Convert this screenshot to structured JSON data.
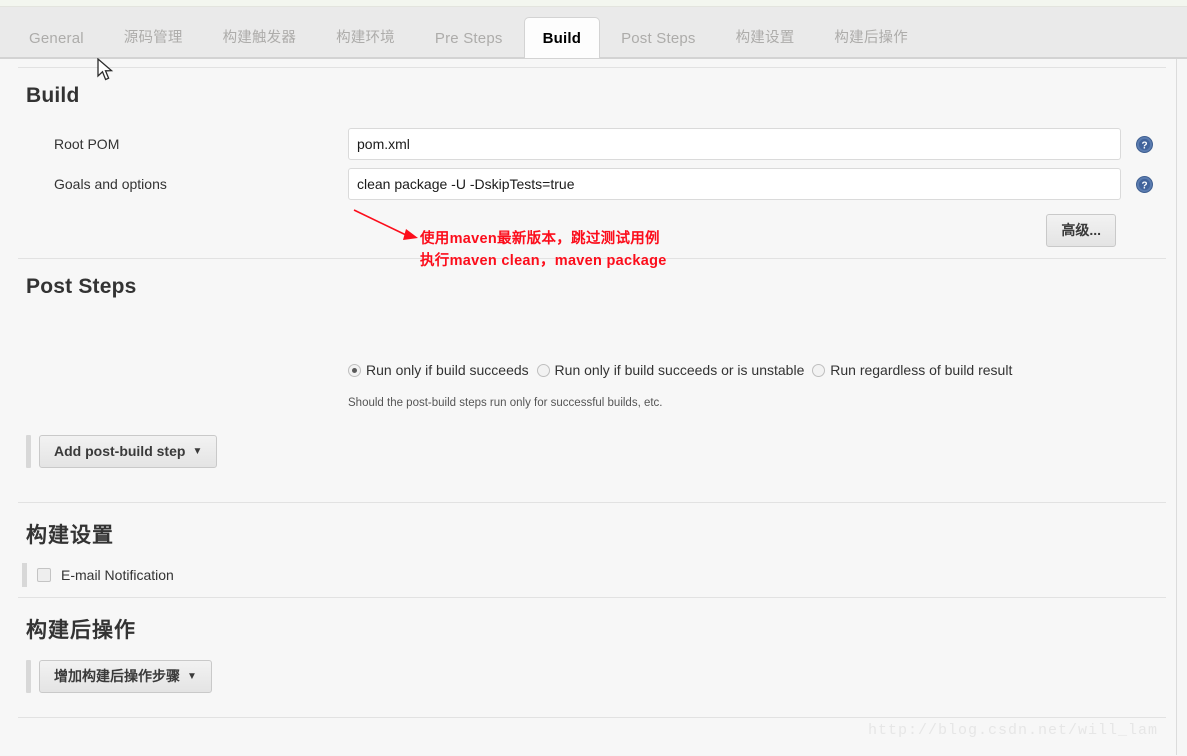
{
  "window": {
    "title": "Jenkins Job Configuration",
    "watermark": "http://blog.csdn.net/will_lam"
  },
  "tabs": [
    {
      "label": "General",
      "active": false
    },
    {
      "label": "源码管理",
      "active": false
    },
    {
      "label": "构建触发器",
      "active": false
    },
    {
      "label": "构建环境",
      "active": false
    },
    {
      "label": "Pre Steps",
      "active": false
    },
    {
      "label": "Build",
      "active": true
    },
    {
      "label": "Post Steps",
      "active": false
    },
    {
      "label": "构建设置",
      "active": false
    },
    {
      "label": "构建后操作",
      "active": false
    }
  ],
  "build": {
    "title": "Build",
    "root_pom": {
      "label": "Root POM",
      "value": "pom.xml",
      "placeholder": "",
      "help_icon": "help-icon"
    },
    "goals": {
      "label": "Goals and options",
      "value": "clean package -U -DskipTests=true",
      "placeholder": "",
      "help_icon": "help-icon"
    },
    "advanced_button": "高级...",
    "annotation": {
      "line1": "使用maven最新版本，跳过测试用例",
      "line2": "执行maven clean，maven package",
      "color": "#fc0d1b"
    }
  },
  "post_steps": {
    "title": "Post Steps",
    "radios": [
      {
        "label": "Run only if build succeeds",
        "selected": true
      },
      {
        "label": "Run only if build succeeds or is unstable",
        "selected": false
      },
      {
        "label": "Run regardless of build result",
        "selected": false
      }
    ],
    "hint": "Should the post-build steps run only for successful builds, etc.",
    "add_button": "Add post-build step",
    "caret_icon": "caret-down-icon"
  },
  "build_settings": {
    "title": "构建设置",
    "email_notification": {
      "label": "E-mail Notification",
      "checked": false
    }
  },
  "post_build_actions": {
    "title": "构建后操作",
    "add_button": "增加构建后操作步骤",
    "caret_icon": "caret-down-icon"
  },
  "colors": {
    "tabbar_bg": "#eaeaea",
    "page_bg": "#f7f7f7",
    "active_tab_bg": "#fdfdfd",
    "help_icon_blue": "#4a6ea9",
    "annotation_red": "#fc0d1b"
  }
}
